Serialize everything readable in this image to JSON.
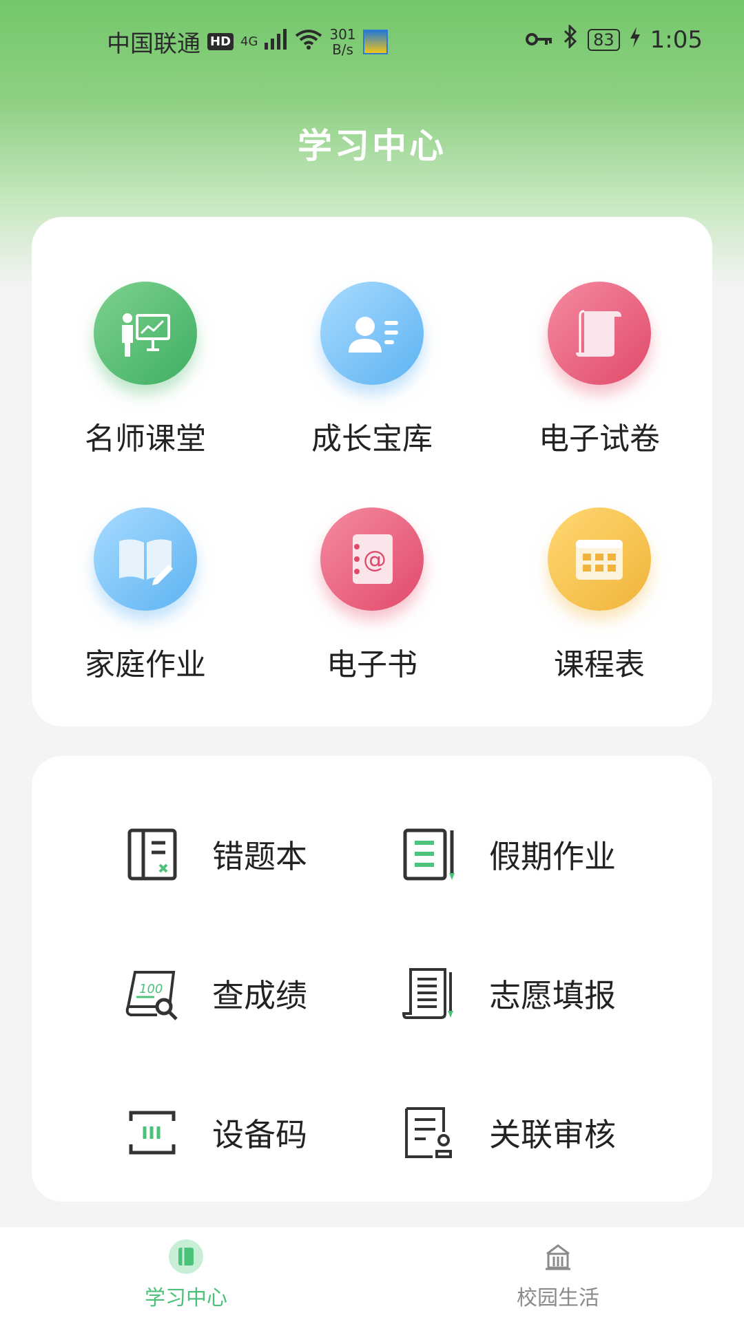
{
  "status_bar": {
    "carrier": "中国联通",
    "hd": "HD",
    "network": "4G",
    "speed_value": "301",
    "speed_unit": "B/s",
    "battery": "83",
    "time": "1:05"
  },
  "header": {
    "title": "学习中心"
  },
  "features": [
    {
      "label": "名师课堂",
      "icon": "teacher-presentation-icon",
      "color": "#4fbf72"
    },
    {
      "label": "成长宝库",
      "icon": "profile-card-icon",
      "color": "#6bbcf5"
    },
    {
      "label": "电子试卷",
      "icon": "scroll-paper-icon",
      "color": "#e8587a"
    },
    {
      "label": "家庭作业",
      "icon": "open-book-pencil-icon",
      "color": "#6bbcf5"
    },
    {
      "label": "电子书",
      "icon": "address-book-icon",
      "color": "#e8587a"
    },
    {
      "label": "课程表",
      "icon": "timetable-grid-icon",
      "color": "#f3bf4a"
    }
  ],
  "tools": [
    {
      "label": "错题本",
      "icon": "notebook-mistakes-icon"
    },
    {
      "label": "假期作业",
      "icon": "holiday-homework-icon"
    },
    {
      "label": "查成绩",
      "icon": "score-search-icon"
    },
    {
      "label": "志愿填报",
      "icon": "application-form-icon"
    },
    {
      "label": "设备码",
      "icon": "device-code-icon"
    },
    {
      "label": "关联审核",
      "icon": "link-review-icon"
    }
  ],
  "bottom_nav": [
    {
      "label": "学习中心",
      "icon": "book-tab-icon",
      "active": true
    },
    {
      "label": "校园生活",
      "icon": "school-building-icon",
      "active": false
    }
  ],
  "colors": {
    "accent": "#4cc17a",
    "header_green": "#74c76b"
  }
}
